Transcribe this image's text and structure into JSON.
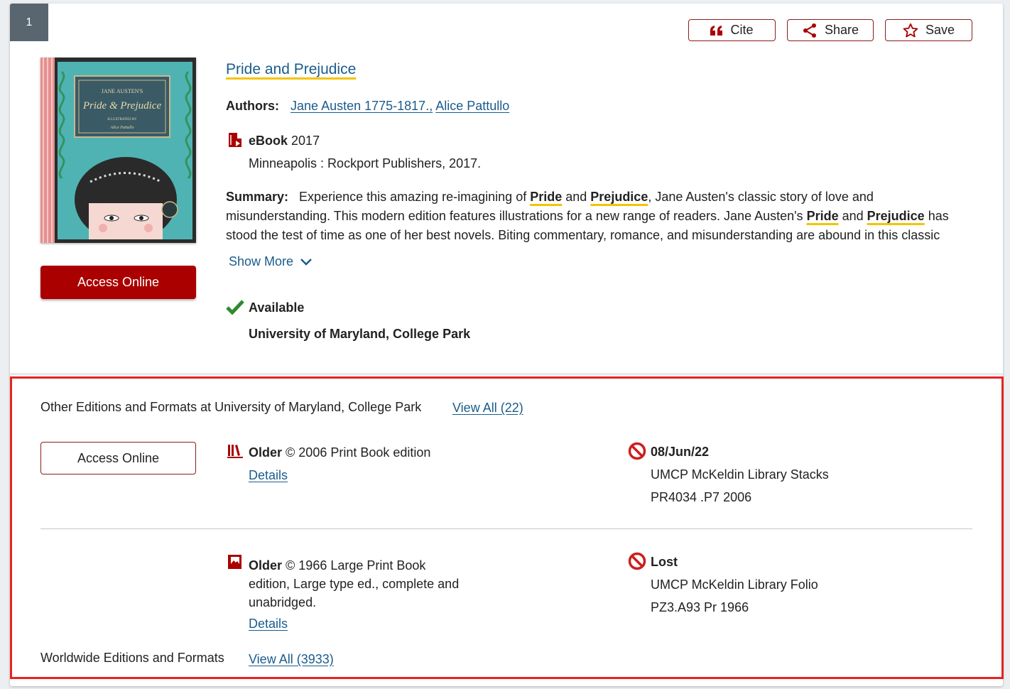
{
  "result": {
    "index": "1",
    "actions": {
      "cite": "Cite",
      "share": "Share",
      "save": "Save"
    },
    "cover": {
      "top_text": "JANE AUSTEN'S",
      "title_text": "Pride & Prejudice",
      "sub_text": "ILLUSTRATED BY",
      "artist_text": "Alice Pattullo"
    },
    "access_online": "Access Online",
    "title": "Pride and Prejudice",
    "authors_label": "Authors:",
    "author1": "Jane Austen 1775-1817.",
    "author_sep": ",",
    "author2": "Alice Pattullo",
    "format_label": "eBook",
    "format_year": "2017",
    "publisher": "Minneapolis : Rockport Publishers, 2017.",
    "summary_label": "Summary:",
    "summary": {
      "p1": "Experience this amazing re-imagining of ",
      "hl1": "Pride",
      "p2": " and ",
      "hl2": "Prejudice",
      "p3": ", Jane Austen's classic story of love and misunderstanding. This modern edition features illustrations for a new range of readers. Jane Austen's ",
      "hl3": "Pride",
      "p4": " and ",
      "hl4": "Prejudice",
      "p5": " has stood the test of time as one of her best novels. Biting commentary, romance, and misunderstanding are abound in this classic"
    },
    "show_more": "Show More",
    "availability": "Available",
    "library": "University of Maryland, College Park"
  },
  "other_editions": {
    "heading": "Other Editions and Formats at University of Maryland, College Park",
    "view_all": "View All (22)",
    "access_online": "Access Online",
    "items": [
      {
        "age": "Older",
        "description": "© 2006 Print Book edition",
        "details": "Details",
        "status": "08/Jun/22",
        "location": "UMCP McKeldin Library Stacks",
        "call_number": "PR4034 .P7 2006"
      },
      {
        "age": "Older",
        "description_line1": "© 1966 Large Print Book",
        "description_line2": "edition, Large type ed., complete and",
        "description_line3": "unabridged.",
        "details": "Details",
        "status": "Lost",
        "location": "UMCP McKeldin Library Folio",
        "call_number": "PZ3.A93 Pr 1966"
      }
    ]
  },
  "worldwide": {
    "heading": "Worldwide Editions and Formats",
    "view_all": "View All (3933)"
  },
  "colors": {
    "brand": "#a00000",
    "link": "#1a5c8c",
    "highlight": "#f4c400",
    "available": "#2e8b2e",
    "unavailable": "#cc1f1f",
    "callout": "#e52421"
  },
  "icons": [
    "quote-icon",
    "share-icon",
    "star-icon",
    "ebook-icon",
    "checkmark-icon",
    "chevron-down-icon",
    "print-book-icon",
    "large-print-book-icon",
    "unavailable-icon"
  ]
}
